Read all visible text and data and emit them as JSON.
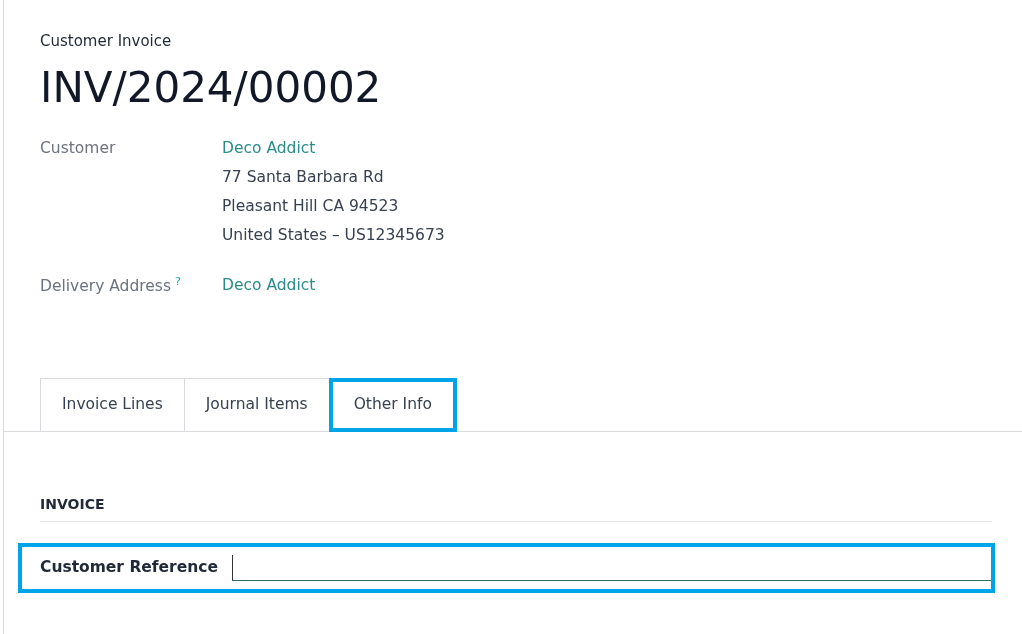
{
  "document_type": "Customer Invoice",
  "number": "INV/2024/00002",
  "fields": [
    {
      "label": "Customer",
      "help": false,
      "link": "Deco Addict",
      "lines": [
        "77 Santa Barbara Rd",
        "Pleasant Hill CA 94523",
        "United States – US12345673"
      ]
    },
    {
      "label": "Delivery Address",
      "help": true,
      "help_mark": "?",
      "link": "Deco Addict"
    }
  ],
  "tabs": [
    {
      "label": "Invoice Lines",
      "selected": false,
      "highlighted": false
    },
    {
      "label": "Journal Items",
      "selected": false,
      "highlighted": false
    },
    {
      "label": "Other Info",
      "selected": true,
      "highlighted": true
    }
  ],
  "section": {
    "title": "INVOICE",
    "rows": [
      {
        "label": "Customer Reference",
        "value": "",
        "highlighted": true
      }
    ]
  }
}
